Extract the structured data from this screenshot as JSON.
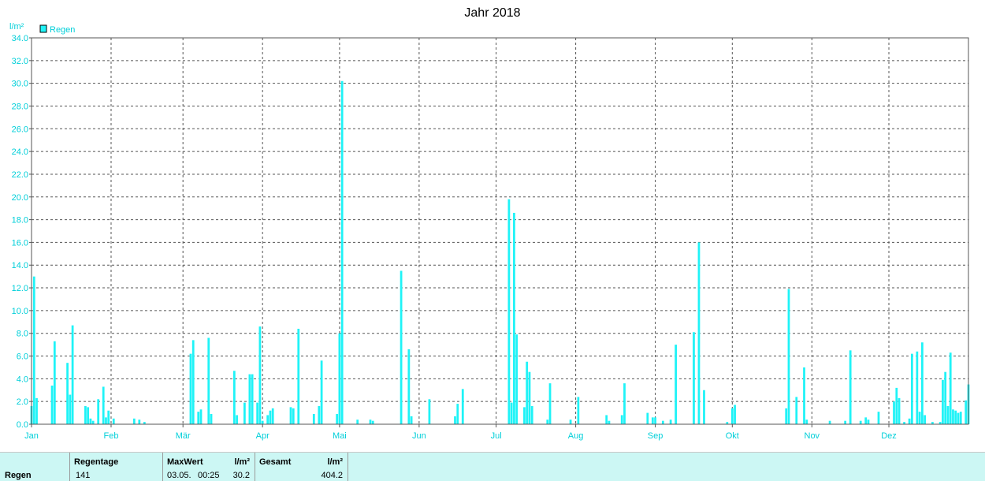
{
  "chart_data": {
    "type": "bar",
    "title": "Jahr 2018",
    "ylabel": "l/m²",
    "ylim": [
      0,
      34
    ],
    "yticks": [
      "0.0",
      "2.0",
      "4.0",
      "6.0",
      "8.0",
      "10.0",
      "12.0",
      "14.0",
      "16.0",
      "18.0",
      "20.0",
      "22.0",
      "24.0",
      "26.0",
      "28.0",
      "30.0",
      "32.0",
      "34.0"
    ],
    "months": [
      "Jan",
      "Feb",
      "Mär",
      "Apr",
      "Mai",
      "Jun",
      "Jul",
      "Aug",
      "Sep",
      "Okt",
      "Nov",
      "Dez"
    ],
    "month_start_day": [
      1,
      32,
      60,
      91,
      121,
      152,
      182,
      213,
      244,
      274,
      305,
      335
    ],
    "grid": true,
    "legend_position": "top-left",
    "series": [
      {
        "name": "Regen",
        "color": "#1ff3f7",
        "points": [
          [
            1,
            1.6
          ],
          [
            2,
            13.0
          ],
          [
            3,
            2.3
          ],
          [
            9,
            3.4
          ],
          [
            10,
            7.3
          ],
          [
            15,
            5.4
          ],
          [
            16,
            2.6
          ],
          [
            17,
            8.7
          ],
          [
            22,
            1.6
          ],
          [
            23,
            1.5
          ],
          [
            24,
            0.5
          ],
          [
            25,
            0.3
          ],
          [
            27,
            2.2
          ],
          [
            29,
            3.3
          ],
          [
            30,
            0.6
          ],
          [
            31,
            1.2
          ],
          [
            33,
            0.5
          ],
          [
            41,
            0.5
          ],
          [
            43,
            0.4
          ],
          [
            45,
            0.2
          ],
          [
            63,
            6.2
          ],
          [
            64,
            7.4
          ],
          [
            66,
            1.1
          ],
          [
            67,
            1.3
          ],
          [
            70,
            7.6
          ],
          [
            71,
            0.9
          ],
          [
            80,
            4.7
          ],
          [
            81,
            0.8
          ],
          [
            84,
            1.9
          ],
          [
            86,
            4.4
          ],
          [
            87,
            4.4
          ],
          [
            89,
            1.9
          ],
          [
            90,
            8.6
          ],
          [
            91,
            0.3
          ],
          [
            93,
            0.8
          ],
          [
            94,
            1.2
          ],
          [
            95,
            1.4
          ],
          [
            102,
            1.5
          ],
          [
            103,
            1.4
          ],
          [
            105,
            8.4
          ],
          [
            111,
            0.9
          ],
          [
            113,
            1.6
          ],
          [
            114,
            5.6
          ],
          [
            120,
            0.9
          ],
          [
            121,
            8.0
          ],
          [
            122,
            30.2
          ],
          [
            128,
            0.4
          ],
          [
            133,
            0.4
          ],
          [
            134,
            0.3
          ],
          [
            145,
            13.5
          ],
          [
            148,
            6.6
          ],
          [
            149,
            0.7
          ],
          [
            156,
            2.2
          ],
          [
            166,
            0.7
          ],
          [
            167,
            1.8
          ],
          [
            169,
            3.1
          ],
          [
            187,
            19.8
          ],
          [
            188,
            1.9
          ],
          [
            189,
            18.6
          ],
          [
            190,
            7.9
          ],
          [
            193,
            1.5
          ],
          [
            194,
            5.5
          ],
          [
            195,
            4.6
          ],
          [
            196,
            1.6
          ],
          [
            202,
            0.4
          ],
          [
            203,
            3.6
          ],
          [
            211,
            0.4
          ],
          [
            214,
            2.4
          ],
          [
            225,
            0.8
          ],
          [
            226,
            0.3
          ],
          [
            231,
            0.8
          ],
          [
            232,
            3.6
          ],
          [
            241,
            1.0
          ],
          [
            243,
            0.6
          ],
          [
            244,
            0.6
          ],
          [
            247,
            0.3
          ],
          [
            250,
            0.4
          ],
          [
            252,
            7.0
          ],
          [
            259,
            8.1
          ],
          [
            261,
            16.0
          ],
          [
            263,
            3.0
          ],
          [
            272,
            0.2
          ],
          [
            274,
            1.4
          ],
          [
            275,
            1.7
          ],
          [
            295,
            1.4
          ],
          [
            296,
            11.9
          ],
          [
            299,
            2.4
          ],
          [
            302,
            5.0
          ],
          [
            303,
            0.4
          ],
          [
            312,
            0.3
          ],
          [
            318,
            0.3
          ],
          [
            320,
            6.5
          ],
          [
            324,
            0.3
          ],
          [
            326,
            0.6
          ],
          [
            327,
            0.4
          ],
          [
            331,
            1.1
          ],
          [
            337,
            2.0
          ],
          [
            338,
            3.2
          ],
          [
            339,
            2.3
          ],
          [
            341,
            0.2
          ],
          [
            343,
            0.5
          ],
          [
            344,
            6.2
          ],
          [
            346,
            6.4
          ],
          [
            347,
            1.1
          ],
          [
            348,
            7.2
          ],
          [
            349,
            0.8
          ],
          [
            352,
            0.2
          ],
          [
            355,
            0.2
          ],
          [
            356,
            3.9
          ],
          [
            357,
            4.6
          ],
          [
            358,
            1.6
          ],
          [
            359,
            6.3
          ],
          [
            360,
            1.3
          ],
          [
            361,
            1.2
          ],
          [
            362,
            1.0
          ],
          [
            363,
            1.1
          ],
          [
            365,
            2.1
          ],
          [
            366,
            3.5
          ]
        ]
      }
    ]
  },
  "legend": {
    "label": "Regen",
    "color": "#1ff3f7"
  },
  "stats": {
    "row_label": "Regen",
    "regentage_label": "Regentage",
    "regentage_value": "141",
    "maxwert_label": "MaxWert",
    "maxwert_unit": "l/m²",
    "maxwert_date": "03.05.",
    "maxwert_time": "00:25",
    "maxwert_value": "30.2",
    "gesamt_label": "Gesamt",
    "gesamt_unit": "l/m²",
    "gesamt_value": "404.2"
  }
}
